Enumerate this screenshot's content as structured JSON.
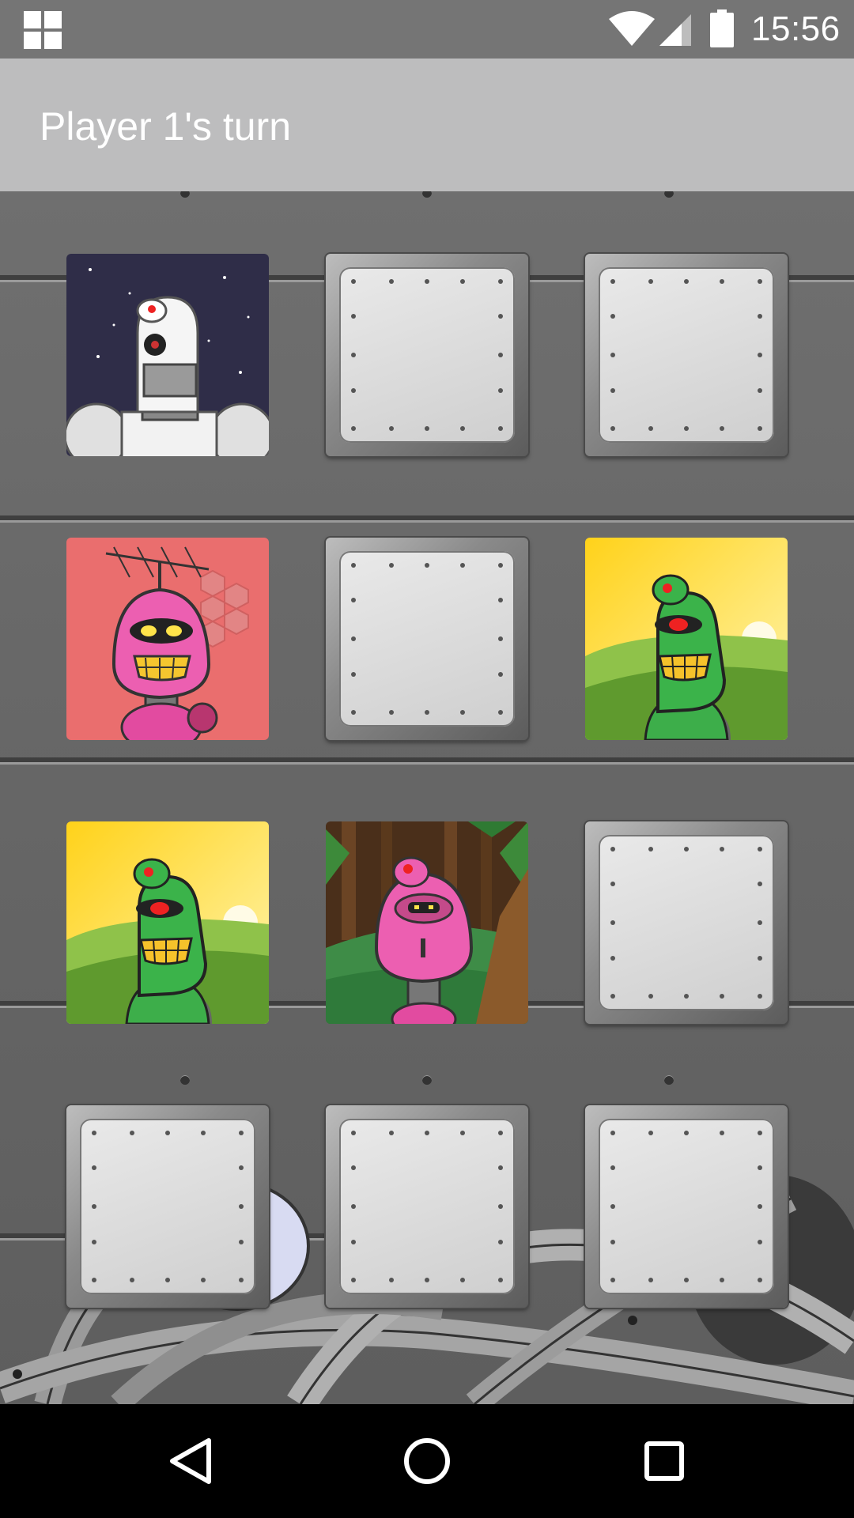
{
  "status_bar": {
    "time": "15:56",
    "icons": [
      "app-grid-icon",
      "wifi-icon",
      "cellular-signal-icon",
      "battery-icon"
    ]
  },
  "action_bar": {
    "title": "Player 1's turn"
  },
  "board": {
    "rows": 4,
    "cols": 3,
    "tiles": [
      {
        "state": "face-up",
        "robot": "white-robot-space"
      },
      {
        "state": "face-down",
        "robot": null
      },
      {
        "state": "face-down",
        "robot": null
      },
      {
        "state": "face-up",
        "robot": "pink-robot-antenna"
      },
      {
        "state": "face-down",
        "robot": null
      },
      {
        "state": "face-up",
        "robot": "green-robot-sunset"
      },
      {
        "state": "face-up",
        "robot": "green-robot-sunset"
      },
      {
        "state": "face-up",
        "robot": "pink-robot-forest"
      },
      {
        "state": "face-down",
        "robot": null
      },
      {
        "state": "face-down",
        "robot": null
      },
      {
        "state": "face-down",
        "robot": null
      },
      {
        "state": "face-down",
        "robot": null
      }
    ]
  },
  "nav_bar": {
    "buttons": [
      "back-icon",
      "home-icon",
      "recents-icon"
    ]
  },
  "colors": {
    "status_bar": "#757575",
    "action_bar": "#bdbdbe",
    "board": "#666666",
    "nav_bar": "#000000"
  }
}
